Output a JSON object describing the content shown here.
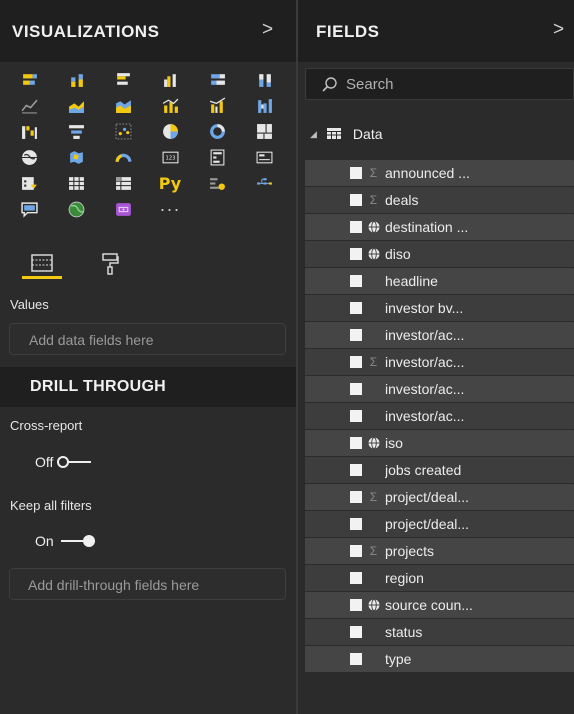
{
  "visualizations": {
    "title": "VISUALIZATIONS",
    "chevron": ">",
    "icons": [
      "stacked-bar-chart-icon",
      "stacked-column-chart-icon",
      "clustered-bar-chart-icon",
      "clustered-column-chart-icon",
      "100-stacked-bar-chart-icon",
      "100-stacked-column-chart-icon",
      "line-chart-icon",
      "area-chart-icon",
      "stacked-area-chart-icon",
      "line-and-stacked-column-chart-icon",
      "line-and-clustered-column-chart-icon",
      "ribbon-chart-icon",
      "waterfall-chart-icon",
      "funnel-chart-icon",
      "scatter-chart-icon",
      "pie-chart-icon",
      "donut-chart-icon",
      "treemap-icon",
      "map-icon",
      "filled-map-icon",
      "gauge-icon",
      "card-icon",
      "multi-row-card-icon",
      "kpi-icon",
      "slicer-icon",
      "table-icon",
      "matrix-icon",
      "python-visual-icon",
      "key-influencers-icon",
      "decomposition-tree-icon",
      "qa-icon",
      "arcgis-map-icon",
      "custom-visual-icon",
      "more-visuals-icon"
    ],
    "py_label": "Py",
    "more_label": "···",
    "tools": [
      "fields-tool-icon",
      "format-paint-roller-icon"
    ],
    "values_label": "Values",
    "values_placeholder": "Add data fields here",
    "drill_title": "DRILL THROUGH",
    "cross_report_label": "Cross-report",
    "cross_report_state": "Off",
    "keep_filters_label": "Keep all filters",
    "keep_filters_state": "On",
    "drill_placeholder": "Add drill-through fields here"
  },
  "fields": {
    "title": "FIELDS",
    "chevron": ">",
    "search_placeholder": "Search",
    "table_name": "Data",
    "items": [
      {
        "name": "announced ...",
        "type": "sigma"
      },
      {
        "name": "deals",
        "type": "sigma"
      },
      {
        "name": "destination ...",
        "type": "globe"
      },
      {
        "name": "diso",
        "type": "globe"
      },
      {
        "name": "headline",
        "type": "text"
      },
      {
        "name": "investor bv...",
        "type": "text"
      },
      {
        "name": "investor/ac...",
        "type": "text"
      },
      {
        "name": "investor/ac...",
        "type": "sigma"
      },
      {
        "name": "investor/ac...",
        "type": "text"
      },
      {
        "name": "investor/ac...",
        "type": "text"
      },
      {
        "name": "iso",
        "type": "globe"
      },
      {
        "name": "jobs created",
        "type": "text"
      },
      {
        "name": "project/deal...",
        "type": "sigma"
      },
      {
        "name": "project/deal...",
        "type": "text"
      },
      {
        "name": "projects",
        "type": "sigma"
      },
      {
        "name": "region",
        "type": "text"
      },
      {
        "name": "source coun...",
        "type": "globe"
      },
      {
        "name": "status",
        "type": "text"
      },
      {
        "name": "type",
        "type": "text"
      }
    ]
  },
  "colors": {
    "accent": "#f2c811",
    "pane_bg": "#2b2b2b",
    "header_bg": "#1f1f1f",
    "field_bg": "#454545"
  }
}
